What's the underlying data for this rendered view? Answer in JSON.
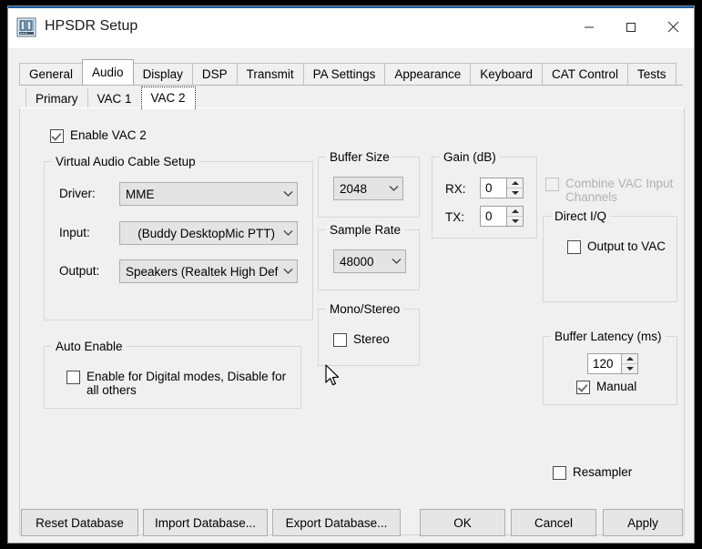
{
  "window": {
    "title": "HPSDR Setup",
    "app_icon": "hpsdr-panel-icon",
    "controls": {
      "minimize": "minimize-icon",
      "maximize": "maximize-icon",
      "close": "close-icon"
    },
    "accent_color": "#0c5aa6",
    "background_color": "#f0f0f0"
  },
  "tabs_outer": [
    {
      "label": "General",
      "selected": false
    },
    {
      "label": "Audio",
      "selected": true
    },
    {
      "label": "Display",
      "selected": false
    },
    {
      "label": "DSP",
      "selected": false
    },
    {
      "label": "Transmit",
      "selected": false
    },
    {
      "label": "PA Settings",
      "selected": false
    },
    {
      "label": "Appearance",
      "selected": false
    },
    {
      "label": "Keyboard",
      "selected": false
    },
    {
      "label": "CAT Control",
      "selected": false
    },
    {
      "label": "Tests",
      "selected": false
    }
  ],
  "tabs_inner": [
    {
      "label": "Primary",
      "selected": false
    },
    {
      "label": "VAC 1",
      "selected": false
    },
    {
      "label": "VAC 2",
      "selected": true
    }
  ],
  "main": {
    "enable_vac2": {
      "label": "Enable VAC 2",
      "checked": true
    },
    "vac_setup": {
      "title": "Virtual Audio Cable Setup",
      "driver": {
        "label": "Driver:",
        "value": "MME"
      },
      "input": {
        "label": "Input:",
        "value": "(Buddy DesktopMic PTT)"
      },
      "output": {
        "label": "Output:",
        "value": "Speakers (Realtek High Defi"
      }
    },
    "auto_enable": {
      "title": "Auto Enable",
      "checkbox": {
        "label": "Enable for Digital modes, Disable for all others",
        "checked": false
      }
    },
    "buffer_size": {
      "title": "Buffer Size",
      "value": "2048"
    },
    "sample_rate": {
      "title": "Sample Rate",
      "value": "48000"
    },
    "mono_stereo": {
      "title": "Mono/Stereo",
      "stereo": {
        "label": "Stereo",
        "checked": false
      }
    },
    "gain": {
      "title": "Gain (dB)",
      "rx": {
        "label": "RX:",
        "value": "0"
      },
      "tx": {
        "label": "TX:",
        "value": "0"
      }
    },
    "combine_vac": {
      "label": "Combine VAC Input Channels",
      "checked": false,
      "disabled": true
    },
    "direct_iq": {
      "title": "Direct I/Q",
      "output_to_vac": {
        "label": "Output to VAC",
        "checked": false
      }
    },
    "buffer_latency": {
      "title": "Buffer Latency (ms)",
      "value": "120",
      "manual": {
        "label": "Manual",
        "checked": true
      }
    },
    "resampler": {
      "label": "Resampler",
      "checked": false
    }
  },
  "footer": {
    "reset_database": "Reset Database",
    "import_database": "Import Database...",
    "export_database": "Export Database...",
    "ok": "OK",
    "cancel": "Cancel",
    "apply": "Apply"
  }
}
